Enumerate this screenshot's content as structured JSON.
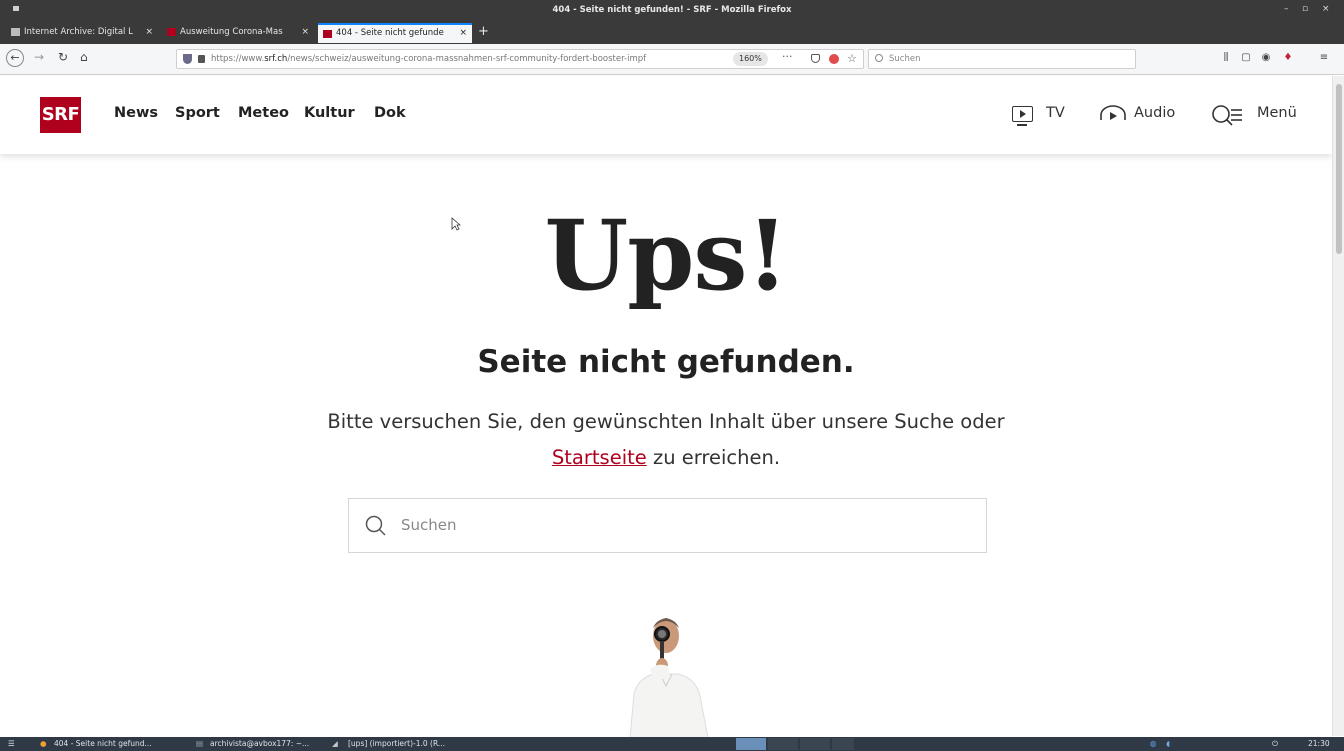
{
  "window": {
    "title": "404 - Seite nicht gefunden! - SRF - Mozilla Firefox",
    "controls": [
      "–",
      "▫",
      "×"
    ]
  },
  "tabs": [
    {
      "label": "Internet Archive: Digital L",
      "active": false
    },
    {
      "label": "Ausweitung Corona-Mas",
      "active": false
    },
    {
      "label": "404 - Seite nicht gefunde",
      "active": true
    }
  ],
  "nav": {
    "url_prefix": "https://www.",
    "url_domain": "srf.ch",
    "url_path": "/news/schweiz/ausweitung-corona-massnahmen-srf-community-fordert-booster-impf",
    "zoom": "160%",
    "search_placeholder": "Suchen"
  },
  "srf": {
    "logo": "SRF",
    "menu": [
      "News",
      "Sport",
      "Meteo",
      "Kultur",
      "Dok"
    ],
    "tv_label": "TV",
    "audio_label": "Audio",
    "menu_label": "Menü"
  },
  "content": {
    "heading": "Ups!",
    "subtitle": "Seite nicht gefunden.",
    "desc_line1": "Bitte versuchen Sie, den gewünschten Inhalt über unsere Suche oder",
    "link": "Startseite",
    "desc_line2": " zu erreichen.",
    "search_placeholder": "Suchen"
  },
  "taskbar": {
    "items": [
      "404 - Seite nicht gefund...",
      "archivista@avbox177: ~...",
      "[ups] (importiert)-1.0 (R..."
    ],
    "clock": "21:30"
  },
  "colors": {
    "brand": "#af001e",
    "titlebar": "#3a3a3a",
    "taskbar": "#2f3a46"
  }
}
